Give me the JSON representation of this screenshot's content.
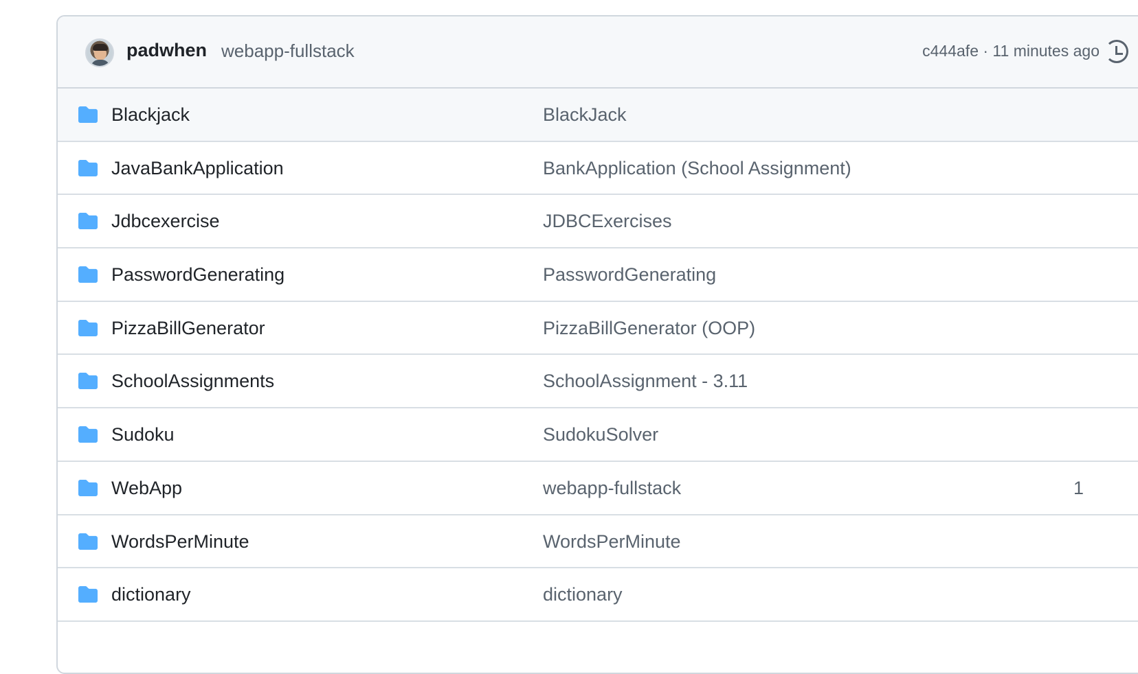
{
  "latest_commit": {
    "author": "padwhen",
    "message": "webapp-fullstack",
    "meta": "c444afe · 11 minutes ago"
  },
  "icons": {
    "avatar": "avatar",
    "history": "history-icon",
    "folder": "folder-icon"
  },
  "colors": {
    "folder": "#54aeff",
    "header_bg": "#f6f8fa",
    "muted_text": "#59636e"
  },
  "files": [
    {
      "name": "Blackjack",
      "message": "BlackJack",
      "age": ""
    },
    {
      "name": "JavaBankApplication",
      "message": "BankApplication (School Assignment)",
      "age": ""
    },
    {
      "name": "Jdbcexercise",
      "message": "JDBCExercises",
      "age": ""
    },
    {
      "name": "PasswordGenerating",
      "message": "PasswordGenerating",
      "age": ""
    },
    {
      "name": "PizzaBillGenerator",
      "message": "PizzaBillGenerator (OOP)",
      "age": ""
    },
    {
      "name": "SchoolAssignments",
      "message": "SchoolAssignment - 3.11",
      "age": ""
    },
    {
      "name": "Sudoku",
      "message": "SudokuSolver",
      "age": ""
    },
    {
      "name": "WebApp",
      "message": "webapp-fullstack",
      "age": "1"
    },
    {
      "name": "WordsPerMinute",
      "message": "WordsPerMinute",
      "age": ""
    },
    {
      "name": "dictionary",
      "message": "dictionary",
      "age": ""
    }
  ]
}
